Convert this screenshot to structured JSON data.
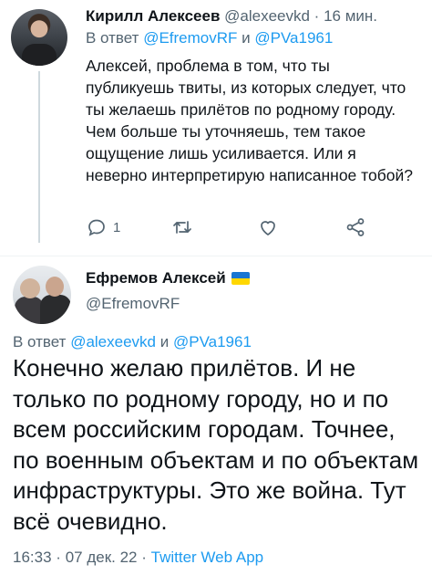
{
  "reply_tweet": {
    "author_name": "Кирилл Алексеев",
    "handle": "@alexeevkd",
    "separator": "·",
    "time": "16 мин.",
    "reply_prefix": "В ответ",
    "reply_to_1": "@EfremovRF",
    "reply_conj": "и",
    "reply_to_2": "@PVa1961",
    "text": "Алексей, проблема в том, что ты публикуешь твиты, из которых следует, что ты желаешь прилётов по родному городу. Чем больше ты уточняешь, тем такое ощущение лишь усиливается. Или я неверно интерпретирую написанное тобой?",
    "reply_count": "1",
    "icons": [
      "reply-icon",
      "retweet-icon",
      "like-icon",
      "share-icon"
    ]
  },
  "main_tweet": {
    "author_name": "Ефремов Алексей",
    "handle": "@EfremovRF",
    "flag": {
      "top_color": "#1976d2",
      "bottom_color": "#ffd700"
    },
    "reply_prefix": "В ответ",
    "reply_to_1": "@alexeevkd",
    "reply_conj": "и",
    "reply_to_2": "@PVa1961",
    "text": "Конечно желаю прилётов. И не только по родному городу, но и по всем российским городам. Точнее, по военным объектам и по объектам инфраструктуры. Это же война. Тут всё очевидно.",
    "time": "16:33",
    "separator": "·",
    "date": "07 дек. 22",
    "source": "Twitter Web App"
  },
  "colors": {
    "link": "#1d9bf0",
    "muted": "#536471",
    "text": "#0f1419"
  }
}
